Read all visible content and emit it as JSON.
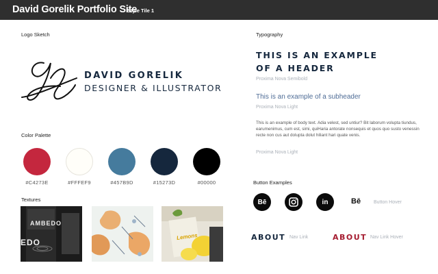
{
  "header": {
    "title": "David Gorelik Portfolio Site",
    "subtitle": "Style Tile 1"
  },
  "logo": {
    "section_label": "Logo Sketch",
    "name": "DAVID GORELIK",
    "role": "DESIGNER & ILLUSTRATOR",
    "icon": "signature-dg-icon"
  },
  "palette": {
    "section_label": "Color Palette",
    "colors": [
      {
        "hex": "#C4273E",
        "label": "#C4273E"
      },
      {
        "hex": "#FFFEF9",
        "label": "#FFFEF9"
      },
      {
        "hex": "#457B9D",
        "label": "#457B9D"
      },
      {
        "hex": "#15273D",
        "label": "#15273D"
      },
      {
        "hex": "#000000",
        "label": "#00000"
      }
    ]
  },
  "textures": {
    "section_label": "Textures",
    "items": [
      {
        "name": "dark-bottle-texture",
        "text_top": "AMBEDO",
        "text_bottom": "EDO"
      },
      {
        "name": "watercolor-flowers-texture"
      },
      {
        "name": "lemon-product-texture",
        "text": "Lemons"
      }
    ]
  },
  "typography": {
    "section_label": "Typography",
    "header_line1": "THIS IS AN EXAMPLE",
    "header_line2": "OF A HEADER",
    "header_font": "Proxima Nova Semibold",
    "subheader": "This is an example of a subheader",
    "subheader_font": "Proxima Nova Light",
    "body": "This is an example of body text. Adia velest, sed untiur? Bit laborum volupta tiundus, earumenimus, cum est, simi, quiHaria antorate nonsequis et quos quo susto venessin recte non cus aut dolupta dolut hiliant hari quate venis.",
    "body_font": "Proxima Nova Light"
  },
  "buttons": {
    "section_label": "Button Examples",
    "behance": "Bē",
    "linkedin": "in",
    "hover_icon": "Bē",
    "hover_label": "Button Hover"
  },
  "nav": {
    "link": "ABOUT",
    "link_note": "Nav Link",
    "hover_link": "ABOUT",
    "hover_note": "Nav Link Hover",
    "color": "#15273D",
    "hover_color": "#A51C30"
  }
}
